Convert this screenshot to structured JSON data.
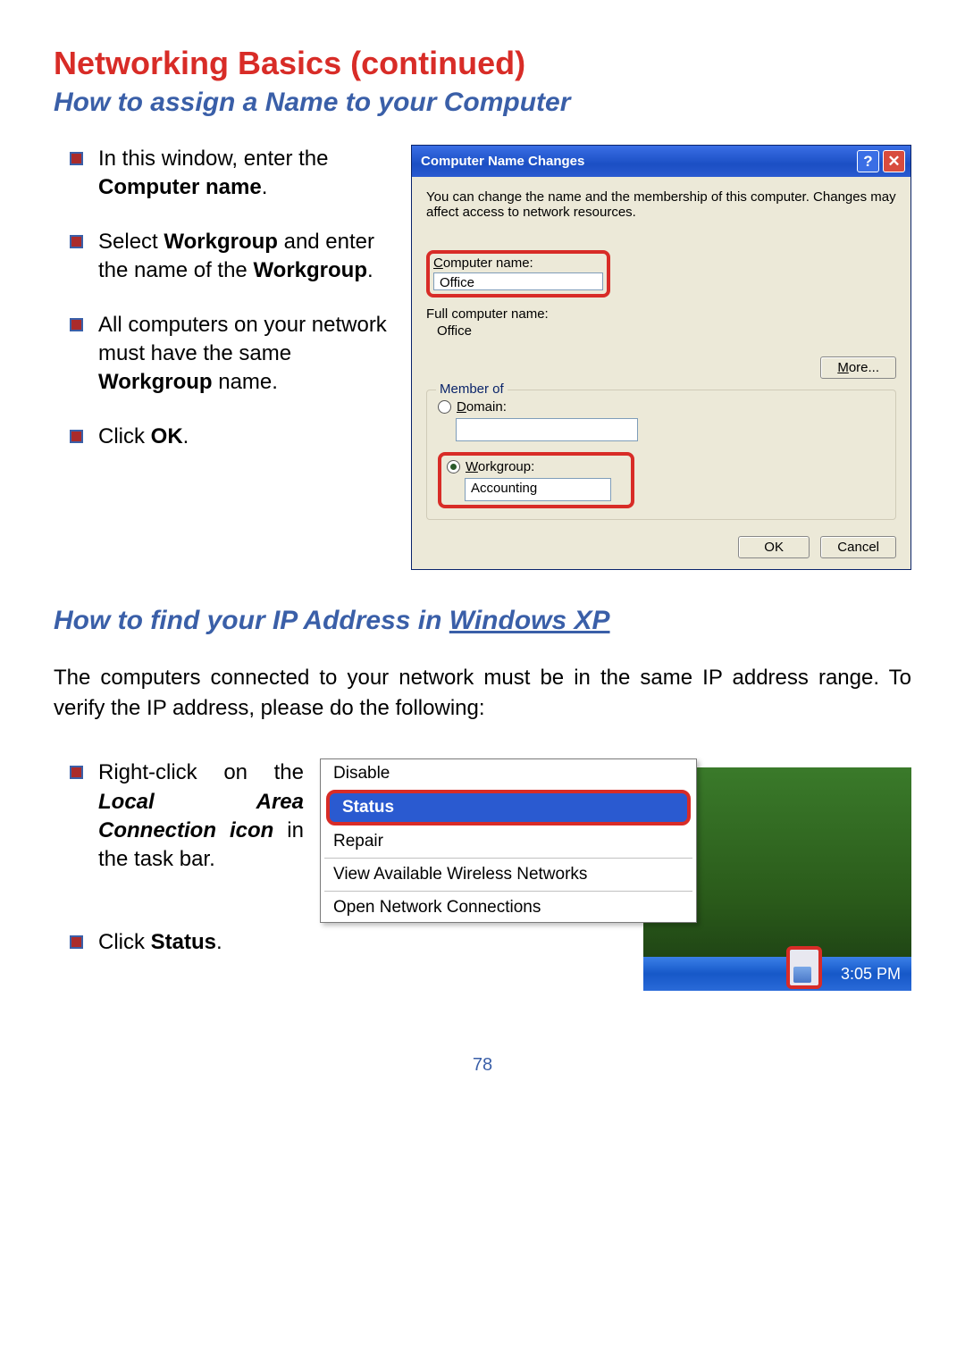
{
  "headings": {
    "h1": "Networking Basics (continued)",
    "h2a": "How to assign a Name to your Computer",
    "h2b_prefix": "How to find your IP Address in ",
    "h2b_underline": "Windows XP"
  },
  "instructions1": [
    {
      "pre": "In this window, enter the ",
      "bold": "Computer name",
      "post": "."
    },
    {
      "pre": "Select ",
      "bold": "Workgroup",
      "mid": " and enter the name of the ",
      "bold2": "Workgroup",
      "post": "."
    },
    {
      "pre": "All computers on your network must have the same ",
      "bold": "Workgroup",
      "post": " name."
    },
    {
      "pre": "Click ",
      "bold": "OK",
      "post": "."
    }
  ],
  "dialog": {
    "title": "Computer Name Changes",
    "desc": "You can change the name and the membership of this computer. Changes may affect access to network resources.",
    "computer_name_label_u": "C",
    "computer_name_label_rest": "omputer name:",
    "computer_name_value": "Office",
    "full_name_label": "Full computer name:",
    "full_name_value": "Office",
    "more_u": "M",
    "more_rest": "ore...",
    "member_of": "Member of",
    "domain_u": "D",
    "domain_rest": "omain:",
    "domain_value": "",
    "workgroup_u": "W",
    "workgroup_rest": "orkgroup:",
    "workgroup_value": "Accounting",
    "ok": "OK",
    "cancel": "Cancel"
  },
  "para2": "The computers connected to your network must be in the same IP address range. To verify the IP address, please do the following:",
  "instructions2": [
    {
      "pre": "Right-click on the ",
      "italic": "Local Area Connection icon",
      "mid": " in the task bar."
    },
    {
      "pre": "Click ",
      "bold": "Status",
      "post": "."
    }
  ],
  "context_menu": {
    "items": [
      "Disable",
      "Status",
      "Repair",
      "View Available Wireless Networks",
      "Open Network Connections"
    ],
    "highlighted": "Status"
  },
  "taskbar": {
    "time": "3:05 PM"
  },
  "page_number": "78"
}
